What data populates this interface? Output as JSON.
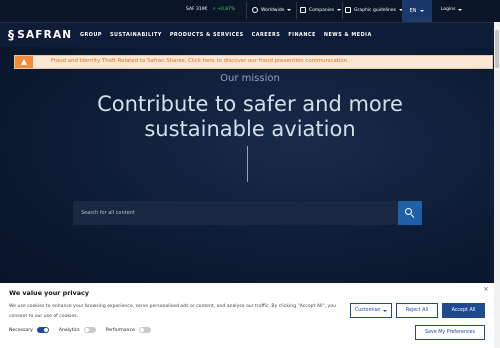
{
  "topbar": {
    "stock_ticker": "SAF 319€",
    "stock_change": "↗ +0.87%",
    "worldwide": "Worldwide",
    "companies": "Companies",
    "graphic_guidelines": "Graphic guidelines",
    "language": "EN",
    "login": "Logins"
  },
  "nav": {
    "logo": "SAFRAN",
    "items": [
      "GROUP",
      "SUSTAINABILITY",
      "PRODUCTS & SERVICES",
      "CAREERS",
      "FINANCE",
      "NEWS & MEDIA"
    ]
  },
  "alert": {
    "text": "Fraud and Identity Theft Related to Safran Shares. Click here to discover our fraud prevention communication."
  },
  "hero": {
    "mission_label": "Our mission",
    "headline_line1": "Contribute to safer and more",
    "headline_line2": "sustainable aviation",
    "search_placeholder": "Search for all content"
  },
  "cookie": {
    "title": "We value your privacy",
    "close": "×",
    "text": "We use cookies to enhance your browsing experience, serve personalised ads or content, and analyse our traffic. By clicking \"Accept All\", you consent to our use of cookies.",
    "toggles": [
      {
        "label": "Necessary",
        "on": true
      },
      {
        "label": "Analytics",
        "on": false
      },
      {
        "label": "Performance",
        "on": false
      }
    ],
    "customise": "Customise",
    "reject": "Reject All",
    "accept": "Accept All",
    "save": "Save My Preferences"
  },
  "colors": {
    "accent": "#1f4a8f",
    "alert_bg": "#fbe8d4",
    "alert_text": "#e46e1c",
    "positive": "#3fcf6a"
  }
}
